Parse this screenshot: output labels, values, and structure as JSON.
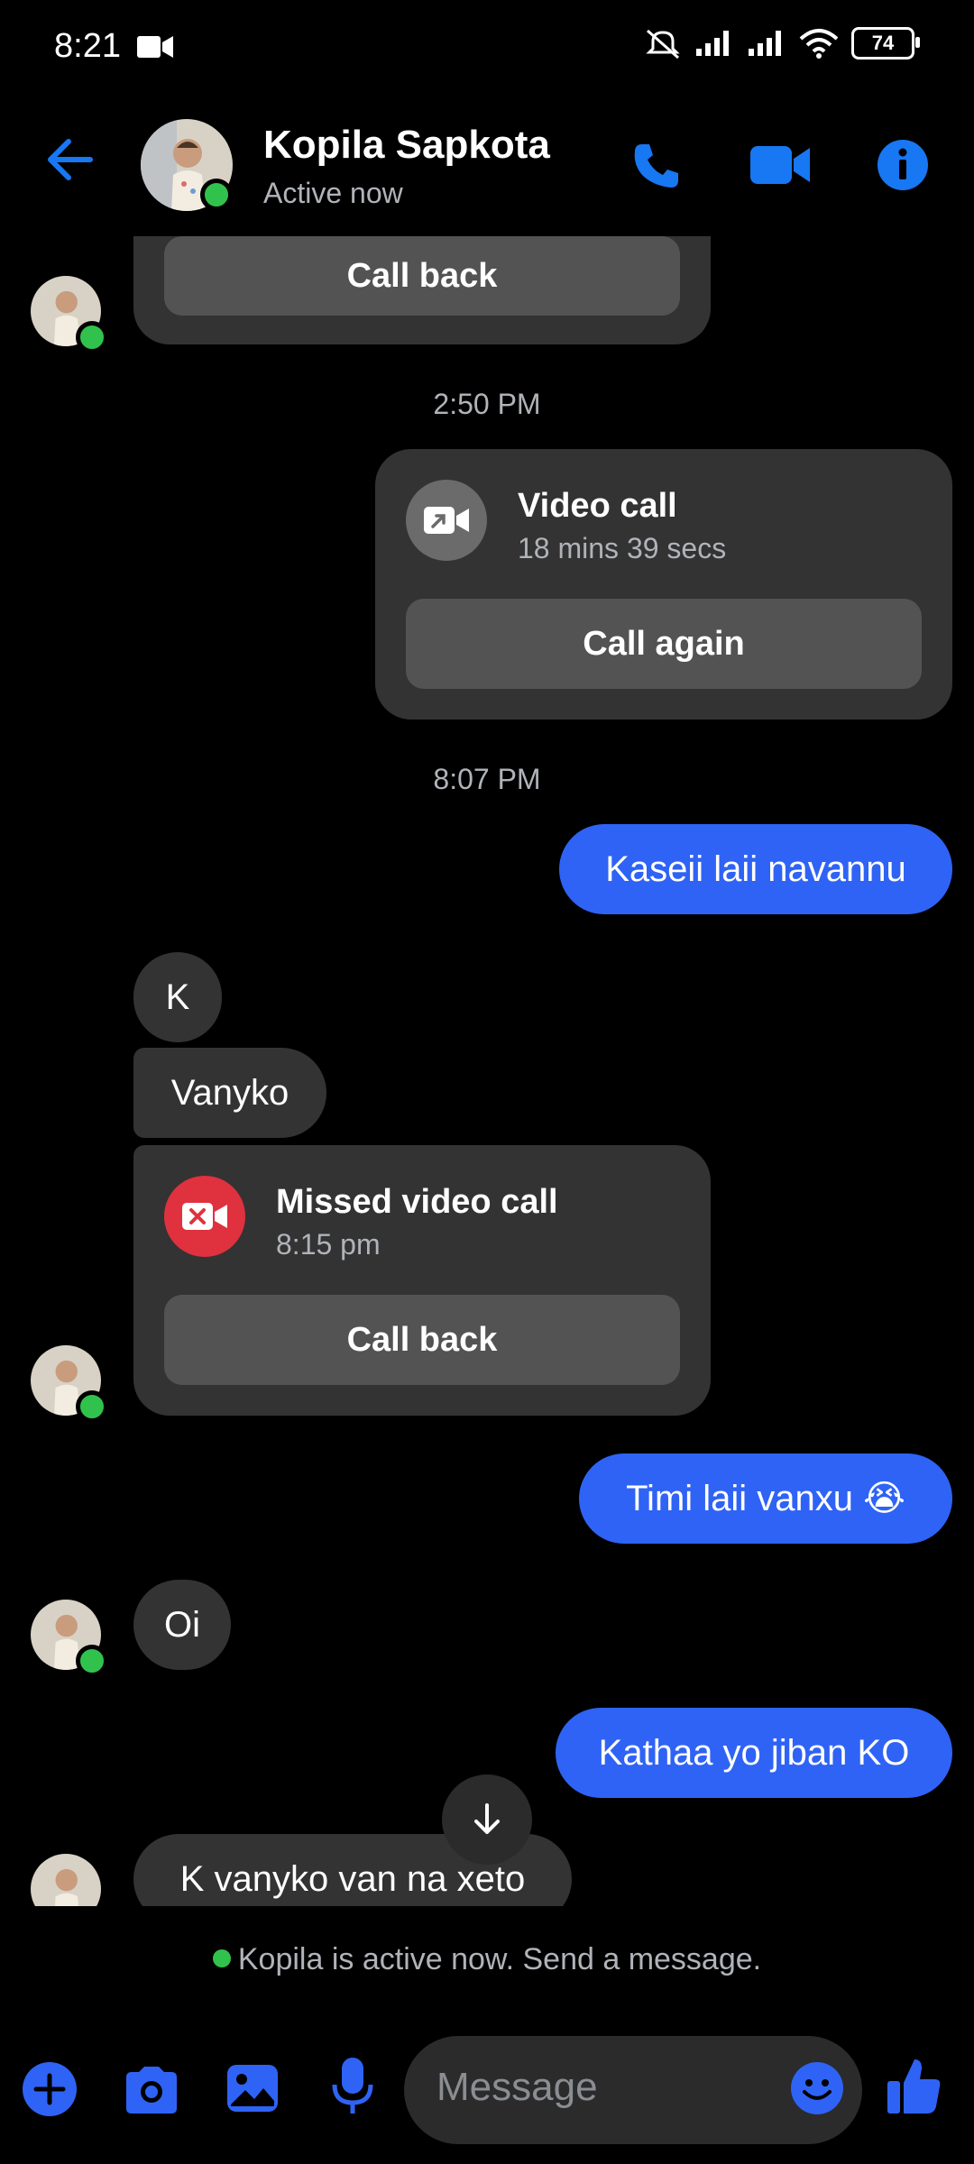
{
  "status_bar": {
    "time": "8:21",
    "battery": "74"
  },
  "header": {
    "contact_name": "Kopila Sapkota",
    "contact_status": "Active now"
  },
  "messages": {
    "top_call_back": "Call back",
    "time_1": "2:50 PM",
    "video_call": {
      "title": "Video call",
      "duration": "18 mins 39 secs",
      "button": "Call again"
    },
    "time_2": "8:07 PM",
    "out_1": "Kaseii laii navannu",
    "in_1": "K",
    "in_2": "Vanyko",
    "missed_call": {
      "title": "Missed video call",
      "time": "8:15 pm",
      "button": "Call back"
    },
    "out_2": "Timi laii vanxu 😭",
    "in_3": "Oi",
    "out_3": "Kathaa yo jiban KO",
    "in_4": "K vanyko van na xeto"
  },
  "footer": {
    "active_note": "Kopila is active now. Send a message.",
    "message_placeholder": "Message"
  },
  "colors": {
    "accent": "#2f63f5",
    "icon_blue": "#1877f2",
    "online": "#31c24d",
    "missed_red": "#e0313f"
  }
}
